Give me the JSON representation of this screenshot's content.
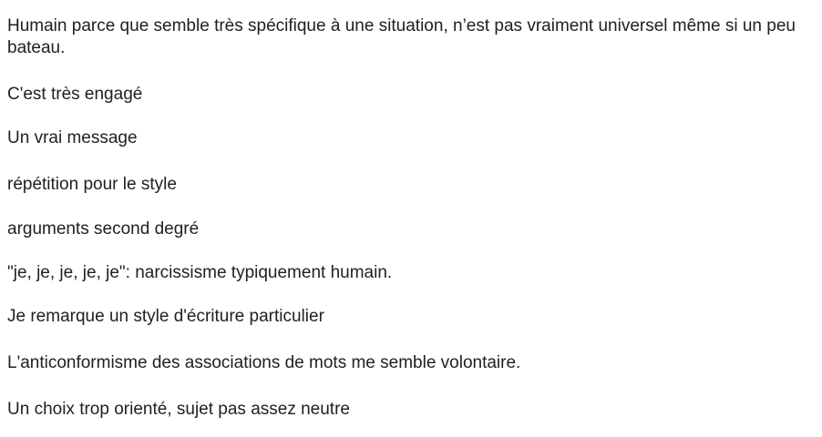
{
  "comments": [
    "Humain parce que semble très spécifique à une situation, n’est pas vraiment universel même si un peu bateau.",
    "C'est très engagé",
    "Un vrai message",
    "répétition pour le style",
    "arguments second degré",
    "\"je, je, je, je, je\": narcissisme typiquement humain.",
    "Je remarque un style d'écriture particulier",
    "L'anticonformisme des associations de mots me semble volontaire.",
    "Un choix trop orienté, sujet pas assez neutre"
  ]
}
